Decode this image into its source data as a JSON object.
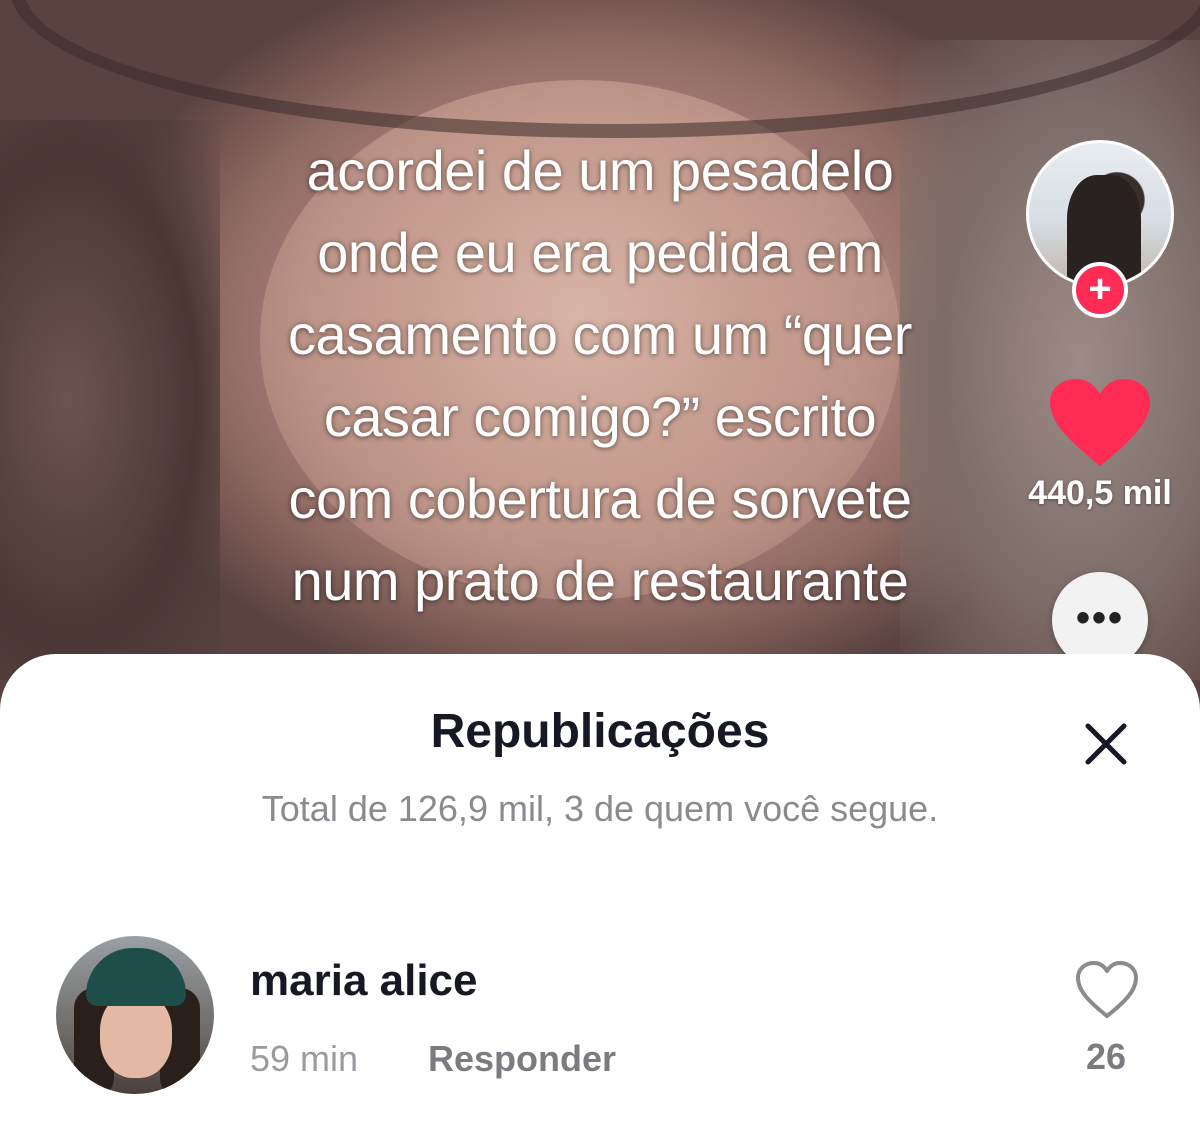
{
  "video": {
    "caption": "acordei de um pesadelo\nonde eu era pedida em\ncasamento com um “quer\ncasar comigo?” escrito\ncom cobertura de sorvete\nnum prato de restaurante",
    "likes_count": "440,5 mil",
    "follow_symbol": "+",
    "more_symbol": "•••"
  },
  "sheet": {
    "title": "Republicações",
    "subtitle": "Total de 126,9 mil, 3 de quem você segue."
  },
  "reposts": [
    {
      "name": "maria alice",
      "time": "59 min",
      "reply_label": "Responder",
      "likes": "26"
    }
  ],
  "colors": {
    "accent": "#fe2c55",
    "text_primary": "#161823",
    "text_secondary": "#8a8b91"
  },
  "icons": [
    "plus-icon",
    "heart-icon",
    "more-icon",
    "close-icon",
    "heart-outline-icon"
  ]
}
